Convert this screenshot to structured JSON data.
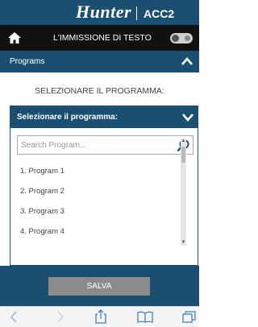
{
  "header": {
    "logo_text": "Hunter",
    "model": "ACC2",
    "nav_title": "L'IMMISSIONE DI TESTO"
  },
  "programs_section": {
    "title": "Programs"
  },
  "question": "SELEZIONARE IL PROGRAMMA:",
  "selector": {
    "title": "Selezionare il programma:",
    "search_placeholder": "Search Program...",
    "items": [
      "1. Program 1",
      "2. Program 2",
      "3. Program 3",
      "4. Program 4"
    ]
  },
  "footer": {
    "save_label": "SALVA"
  },
  "colors": {
    "brand_blue": "#1b4f72",
    "nav_black": "#111111",
    "save_gray": "#8b8b8b"
  },
  "icons": [
    "home-icon",
    "toggle-switch",
    "chevron-up-icon",
    "chevron-down-icon",
    "search-icon",
    "back-icon",
    "forward-icon",
    "share-icon",
    "bookmarks-icon",
    "tabs-icon"
  ]
}
